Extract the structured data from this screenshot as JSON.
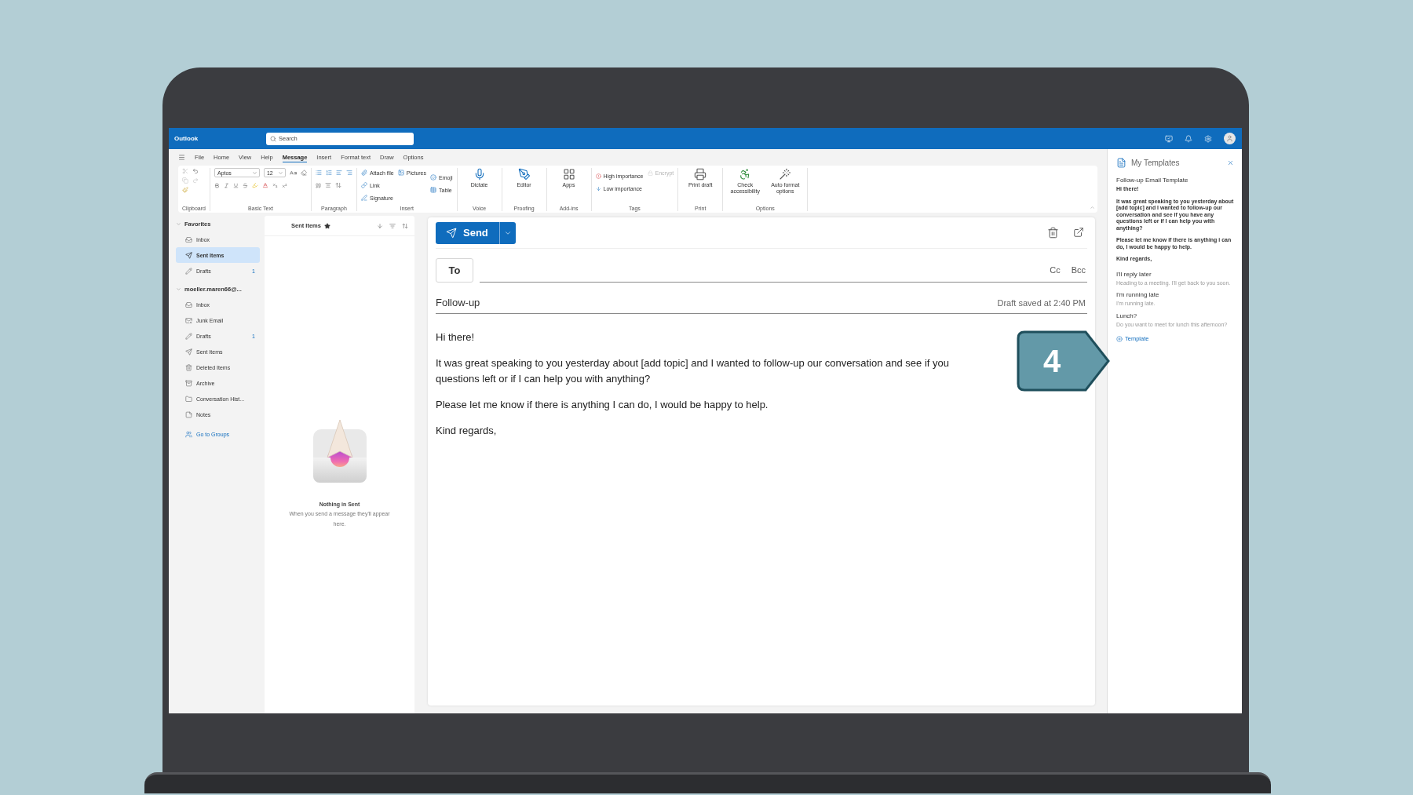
{
  "app": {
    "name": "Outlook",
    "search_placeholder": "Search"
  },
  "menu_tabs": [
    {
      "label": "File",
      "selected": false
    },
    {
      "label": "Home",
      "selected": false
    },
    {
      "label": "View",
      "selected": false
    },
    {
      "label": "Help",
      "selected": false
    },
    {
      "label": "Message",
      "selected": true
    },
    {
      "label": "Insert",
      "selected": false
    },
    {
      "label": "Format text",
      "selected": false
    },
    {
      "label": "Draw",
      "selected": false
    },
    {
      "label": "Options",
      "selected": false
    }
  ],
  "ribbon_groups": [
    {
      "kind": "clipboard",
      "label": "Clipboard"
    },
    {
      "kind": "basic_text",
      "label": "Basic Text",
      "font": "Aptos",
      "size": "12"
    },
    {
      "kind": "paragraph",
      "label": "Paragraph"
    },
    {
      "kind": "insert",
      "label": "Insert",
      "buttons": [
        {
          "label": "Attach file"
        },
        {
          "label": "Pictures"
        },
        {
          "label": "Link"
        },
        {
          "label": "Emoji"
        },
        {
          "label": "Signature"
        },
        {
          "label": "Table"
        }
      ]
    },
    {
      "kind": "voice",
      "label": "Voice",
      "buttons": [
        {
          "label": "Dictate"
        }
      ]
    },
    {
      "kind": "proofing",
      "label": "Proofing",
      "buttons": [
        {
          "label": "Editor"
        }
      ]
    },
    {
      "kind": "addins",
      "label": "Add-ins",
      "buttons": [
        {
          "label": "Apps"
        }
      ]
    },
    {
      "kind": "tags",
      "label": "Tags",
      "buttons": [
        {
          "label": "High importance",
          "disabled": false
        },
        {
          "label": "Low importance",
          "disabled": false
        },
        {
          "label": "Encrypt",
          "disabled": true
        }
      ]
    },
    {
      "kind": "print",
      "label": "Print",
      "buttons": [
        {
          "label": "Print draft"
        }
      ]
    },
    {
      "kind": "options",
      "label": "Options",
      "buttons": [
        {
          "label": "Check accessibility"
        },
        {
          "label": "Auto format options"
        }
      ]
    }
  ],
  "nav": {
    "sections": [
      {
        "label": "Favorites",
        "expanded": true,
        "items": [
          {
            "kind": "inbox",
            "label": "Inbox",
            "selected": false
          },
          {
            "kind": "sent",
            "label": "Sent Items",
            "selected": true
          },
          {
            "kind": "drafts",
            "label": "Drafts",
            "count": "1",
            "selected": false
          }
        ]
      },
      {
        "label": "moeller.maren66@...",
        "expanded": true,
        "items": [
          {
            "kind": "inbox",
            "label": "Inbox",
            "selected": false
          },
          {
            "kind": "junk",
            "label": "Junk Email",
            "selected": false
          },
          {
            "kind": "drafts",
            "label": "Drafts",
            "count": "1",
            "selected": false
          },
          {
            "kind": "sent",
            "label": "Sent Items",
            "selected": false
          },
          {
            "kind": "deleted",
            "label": "Deleted Items",
            "selected": false
          },
          {
            "kind": "archive",
            "label": "Archive",
            "selected": false
          },
          {
            "kind": "folder",
            "label": "Conversation Hist...",
            "selected": false
          },
          {
            "kind": "notes",
            "label": "Notes",
            "selected": false
          }
        ]
      }
    ],
    "groups_link": "Go to Groups"
  },
  "list_pane": {
    "title": "Sent Items",
    "favorite": true,
    "empty_title": "Nothing in Sent",
    "empty_text": "When you send a message they'll appear here."
  },
  "compose": {
    "send": "Send",
    "to": "To",
    "cc": "Cc",
    "bcc": "Bcc",
    "subject": "Follow-up",
    "draft_status": "Draft saved at 2:40 PM",
    "body": [
      {
        "lines": [
          "Hi there!"
        ]
      },
      {
        "lines": [
          "It was great speaking to you yesterday about [add topic] and I wanted to follow-up our conversation and see if you",
          "questions left or if I can help you with anything?"
        ]
      },
      {
        "lines": [
          "Please let me know if there is anything I can do, I would be happy to help."
        ]
      },
      {
        "lines": [
          "Kind regards,"
        ]
      }
    ]
  },
  "templates_pane": {
    "title": "My Templates",
    "templates": [
      {
        "title": "Follow-up Email Template",
        "body": [
          "Hi there!",
          "It was great speaking to you yesterday about [add topic] and I wanted to follow-up our conversation and see if you have any questions left or if I can help you with anything?",
          "Please let me know if there is anything i can do, I would be happy to help.",
          "Kind regards,"
        ]
      },
      {
        "title": "I'll reply later",
        "preview": "Heading to a meeting. I'll get back to you soon."
      },
      {
        "title": "I'm running late",
        "preview": "I'm running late."
      },
      {
        "title": "Lunch?",
        "preview": "Do you want to meet for lunch this afternoon?"
      }
    ],
    "add_button": "Template"
  },
  "callout": {
    "label": "4"
  }
}
